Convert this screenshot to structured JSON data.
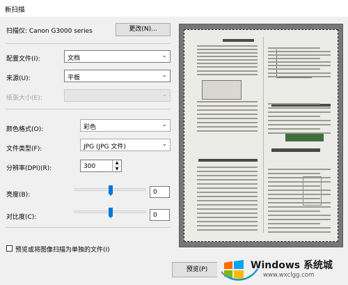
{
  "window": {
    "title": "新扫描"
  },
  "scanner": {
    "label": "扫描仪: Canon G3000 series",
    "change_button": "更改(N)..."
  },
  "fields": {
    "profile": {
      "label": "配置文件(I):",
      "value": "文档"
    },
    "source": {
      "label": "来源(U):",
      "value": "平板"
    },
    "paper_size": {
      "label": "纸张大小(E):",
      "value": ""
    },
    "color_format": {
      "label": "颜色格式(O):",
      "value": "彩色"
    },
    "file_type": {
      "label": "文件类型(F):",
      "value": "JPG (JPG 文件)"
    },
    "resolution": {
      "label": "分辨率(DPI)(R):",
      "value": "300"
    },
    "brightness": {
      "label": "亮度(B):",
      "value": "0",
      "level": 0.5
    },
    "contrast": {
      "label": "对比度(C):",
      "value": "0",
      "level": 0.5
    }
  },
  "checkbox": {
    "label": "预览或将图像扫描为单独的文件(I)",
    "checked": false
  },
  "buttons": {
    "preview": "预览(P)"
  },
  "watermark": {
    "brand": "Windows 系统城",
    "url": "www.wxclgg.com"
  }
}
